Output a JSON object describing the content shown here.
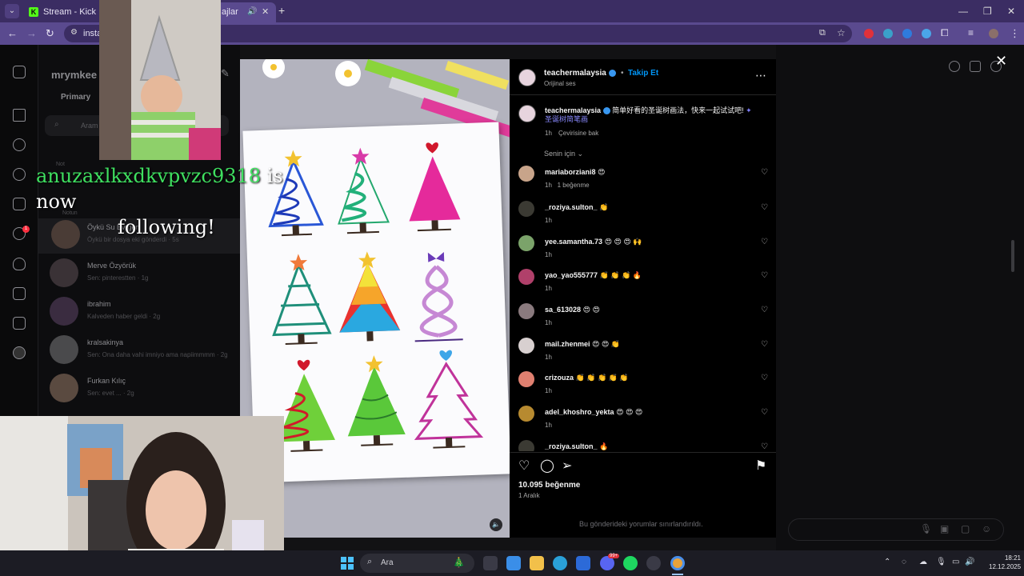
{
  "browser": {
    "tabs": [
      {
        "title": "Stream - Kick Dashboa",
        "active": false
      },
      {
        "title": "ajlar",
        "active": true
      }
    ],
    "address": "insta"
  },
  "instagram": {
    "profile_name": "mrymkee",
    "tab_primary": "Primary",
    "search_placeholder": "Aram",
    "section_label": "Not",
    "notes_label": "Notun",
    "dms": [
      {
        "name": "Öykü Su Evrgen",
        "sub": "Öykü bir dosya eki gönderdi · 5s"
      },
      {
        "name": "Merve Özyörük",
        "sub": "Sen: pinterestten · 1g"
      },
      {
        "name": "ibrahim",
        "sub": "Kalveden haber geldi · 2g"
      },
      {
        "name": "kralsakinya",
        "sub": "Sen: Ona daha vahi imniyo ama napiimmmm · 2g"
      },
      {
        "name": "Furkan Kılıç",
        "sub": "Sen: evet ... · 2g"
      }
    ],
    "notification_count": "1"
  },
  "post": {
    "author": "teachermalaysia",
    "follow_label": "Takip Et",
    "audio_label": "Orijinal ses",
    "caption_text": "简单好看的圣诞树画法，快来一起试试吧!",
    "caption_tag": "圣诞树简笔画",
    "caption_time": "1h",
    "translate_label": "Çevirisine bak",
    "sort_label": "Senin için",
    "comments": [
      {
        "user": "mariaborziani8",
        "text": "😍",
        "time": "1h",
        "likes": "1 beğenme",
        "color": "#c8a48a"
      },
      {
        "user": "_roziya.sulton_",
        "text": "👏",
        "time": "1h",
        "likes": "",
        "color": "#3b3a33"
      },
      {
        "user": "yee.samantha.73",
        "text": "😍 😍 😍 🙌",
        "time": "1h",
        "likes": "",
        "color": "#7ba36a"
      },
      {
        "user": "yao_yao555777",
        "text": "👏 👏 👏 🔥",
        "time": "1h",
        "likes": "",
        "color": "#b0406a"
      },
      {
        "user": "sa_613028",
        "text": "😍 😍",
        "time": "1h",
        "likes": "",
        "color": "#8a7a7e"
      },
      {
        "user": "mail.zhenmei",
        "text": "😍 😍 👏",
        "time": "1h",
        "likes": "",
        "color": "#d8d0d0"
      },
      {
        "user": "crizouza",
        "text": "👏 👏 👏 👏 👏",
        "time": "1h",
        "likes": "",
        "color": "#e08070"
      },
      {
        "user": "adel_khoshro_yekta",
        "text": "😍 😍 😍",
        "time": "1h",
        "likes": "",
        "color": "#b78a30"
      },
      {
        "user": "_roziya.sulton_",
        "text": "🔥",
        "time": "",
        "likes": "",
        "color": "#3b3a33"
      }
    ],
    "likes_count": "10.095 beğenme",
    "post_date": "1 Aralık",
    "comments_limited": "Bu gönderideki yorumlar sınırlandırıldı."
  },
  "stream_overlay": {
    "follower_name": "anuzaxlkxdkvpvzc9318",
    "follow_text": "is now",
    "follow_text2": "following!"
  },
  "taskbar": {
    "search_placeholder": "Ara",
    "time": "18:21",
    "date": "12.12.2025",
    "badge": "99+"
  }
}
